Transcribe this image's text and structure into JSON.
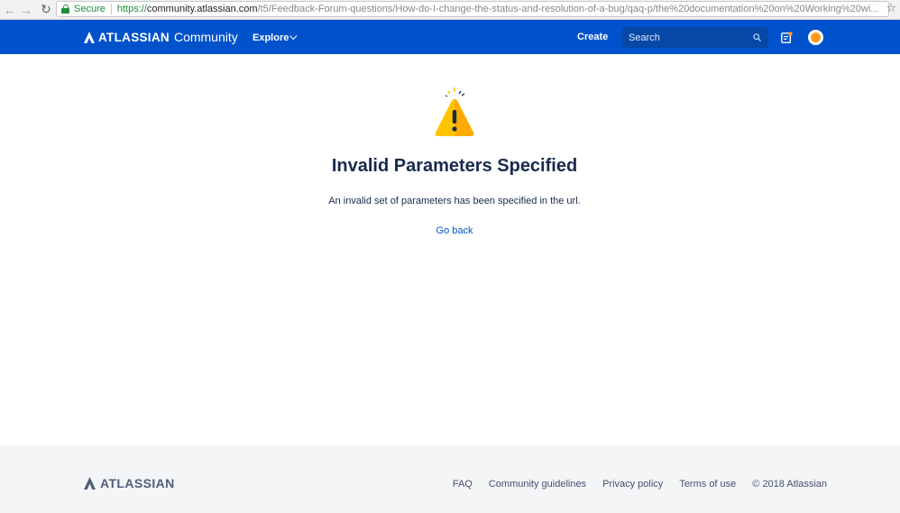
{
  "browser": {
    "secure_label": "Secure",
    "url_protocol": "https://",
    "url_host": "community.atlassian.com",
    "url_path": "/t5/Feedback-Forum-questions/How-do-I-change-the-status-and-resolution-of-a-bug/qaq-p/the%20documentation%20on%20Working%20wi..."
  },
  "header": {
    "brand": "ATLASSIAN",
    "brand_sub": "Community",
    "explore_label": "Explore",
    "create_label": "Create",
    "search_placeholder": "Search"
  },
  "main": {
    "title": "Invalid Parameters Specified",
    "message": "An invalid set of parameters has been specified in the url.",
    "go_back_label": "Go back"
  },
  "footer": {
    "brand": "ATLASSIAN",
    "links": [
      {
        "label": "FAQ"
      },
      {
        "label": "Community guidelines"
      },
      {
        "label": "Privacy policy"
      },
      {
        "label": "Terms of use"
      }
    ],
    "copyright": "© 2018 Atlassian"
  },
  "colors": {
    "header_bg": "#0052cc",
    "link": "#0052cc",
    "warning": "#ffc400",
    "footer_bg": "#f4f5f7"
  }
}
